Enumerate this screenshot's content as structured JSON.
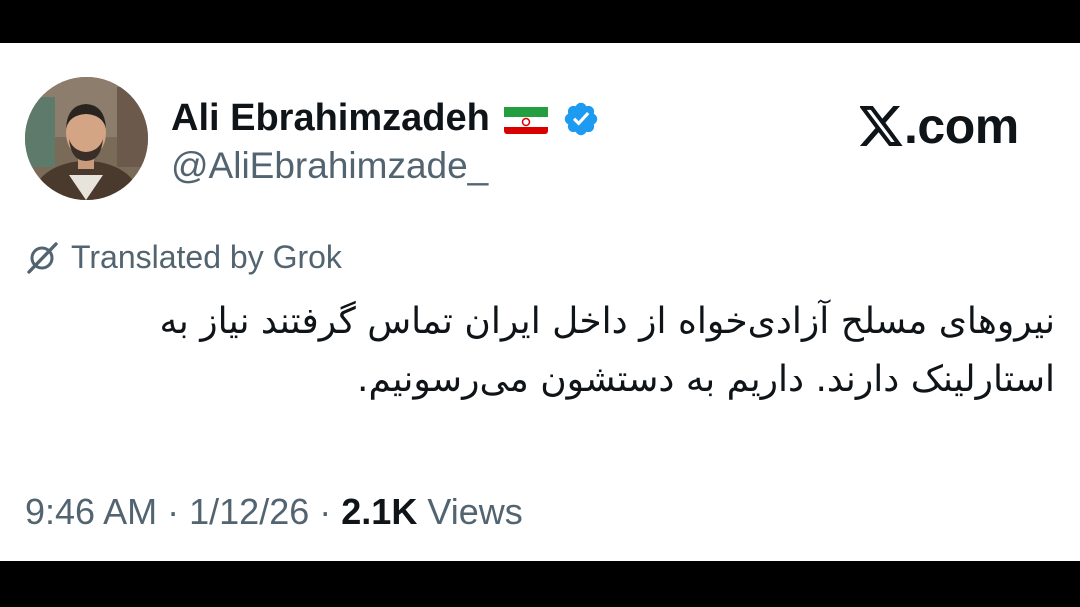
{
  "author": {
    "display_name": "Ali Ebrahimzadeh",
    "handle": "@AliEbrahimzade_",
    "flag_icon": "iran-flag-icon",
    "verified_icon": "verified-badge-icon",
    "verified_color": "#1d9bf0"
  },
  "brand": {
    "logo_icon": "x-logo-icon",
    "domain": ".com"
  },
  "translation": {
    "icon": "grok-icon",
    "label": "Translated by Grok"
  },
  "tweet": {
    "text": "نیروهای مسلح آزادی‌خواه از داخل ایران تماس گرفتند نیاز به استارلینک دارند. داریم به دستشون می‌رسونیم."
  },
  "meta": {
    "time": "9:46 AM",
    "separator": "·",
    "date": "1/12/26",
    "views_count": "2.1K",
    "views_label": "Views"
  },
  "colors": {
    "text_primary": "#0f1419",
    "text_secondary": "#536471",
    "background": "#ffffff",
    "frame": "#000000"
  }
}
